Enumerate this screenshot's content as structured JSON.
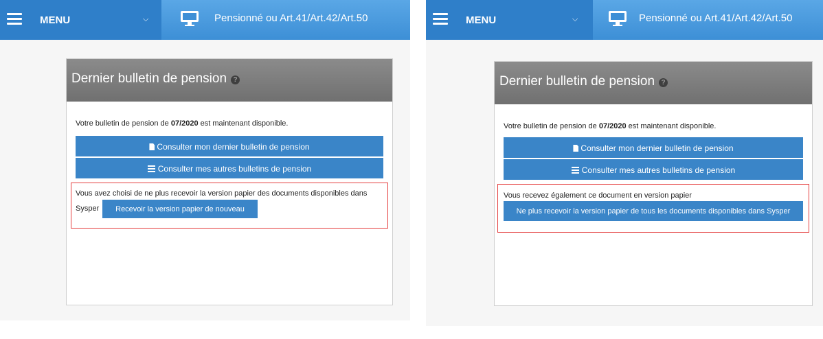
{
  "left": {
    "menu_label": "MENU",
    "topbar_title": "Pensionné ou Art.41/Art.42/Art.50",
    "card_title": "Dernier bulletin de pension",
    "availability": {
      "prefix": "Votre bulletin de pension de ",
      "date": "07/2020",
      "suffix": " est maintenant disponible."
    },
    "btn_last": "Consulter mon dernier bulletin de pension",
    "btn_others": "Consulter mes autres bulletins de pension",
    "paper_notice_line1": "Vous avez choisi de ne plus recevoir la version papier des documents disponibles dans",
    "paper_notice_line2": "Sysper",
    "paper_button": "Recevoir la version papier de nouveau"
  },
  "right": {
    "menu_label": "MENU",
    "topbar_title": "Pensionné ou Art.41/Art.42/Art.50",
    "card_title": "Dernier bulletin de pension",
    "availability": {
      "prefix": "Votre bulletin de pension de ",
      "date": "07/2020",
      "suffix": " est maintenant disponible."
    },
    "btn_last": "Consulter mon dernier bulletin de pension",
    "btn_others": "Consulter mes autres bulletins de pension",
    "paper_notice": "Vous recevez également ce document en version papier",
    "paper_button": "Ne plus recevoir la version papier de tous les documents disponibles dans Sysper"
  },
  "icons": {
    "menu": "hamburger-icon",
    "dropdown": "chevron-down-icon",
    "monitor": "monitor-icon",
    "help": "question-circle-icon",
    "file": "file-icon",
    "list": "list-icon"
  },
  "colors": {
    "topbar": "#3d8fd6",
    "menu_part": "#2f7fc9",
    "button": "#3a85c8",
    "card_header": "#7a7a7a",
    "highlight": "#e43b3b"
  }
}
